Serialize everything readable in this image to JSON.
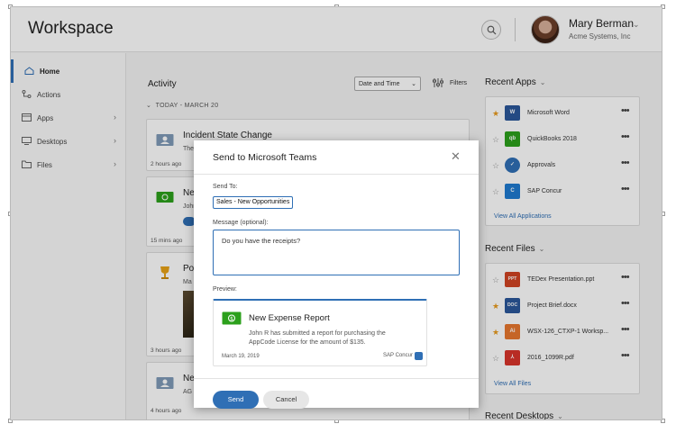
{
  "header": {
    "app_title": "Workspace",
    "user_name": "Mary Berman",
    "user_org": "Acme Systems, Inc"
  },
  "sidebar": {
    "items": [
      {
        "label": "Home",
        "icon": "home-icon"
      },
      {
        "label": "Actions",
        "icon": "actions-icon"
      },
      {
        "label": "Apps",
        "icon": "apps-icon"
      },
      {
        "label": "Desktops",
        "icon": "desktop-icon"
      },
      {
        "label": "Files",
        "icon": "folder-icon"
      }
    ]
  },
  "activity": {
    "title": "Activity",
    "sort_select": "Date and Time",
    "filters_label": "Filters",
    "group_label": "TODAY - MARCH 20",
    "cards": [
      {
        "title": "Incident State Change",
        "body": "The",
        "time": "2 hours ago",
        "icon": "id-card-icon"
      },
      {
        "title": "Ne",
        "body": "John",
        "time": "15 mins ago",
        "icon": "money-icon"
      },
      {
        "title": "Po",
        "body": "Ma",
        "time": "3 hours ago",
        "icon": "trophy-icon"
      },
      {
        "title": "Ne",
        "body": "AG",
        "time": "4 hours ago",
        "icon": "id-card-icon"
      }
    ]
  },
  "recent_apps": {
    "title": "Recent Apps",
    "items": [
      {
        "label": "Microsoft Word",
        "starred": true,
        "icon": "word-icon",
        "color": "#2b579a",
        "glyph": "W"
      },
      {
        "label": "QuickBooks 2018",
        "starred": false,
        "icon": "quickbooks-icon",
        "color": "#2ca01c",
        "glyph": "qb"
      },
      {
        "label": "Approvals",
        "starred": false,
        "icon": "approvals-icon",
        "color": "#2f6fb5",
        "glyph": "✓"
      },
      {
        "label": "SAP Concur",
        "starred": false,
        "icon": "concur-icon",
        "color": "#1f7bd0",
        "glyph": "C"
      }
    ],
    "link": "View All Applications"
  },
  "recent_files": {
    "title": "Recent Files",
    "items": [
      {
        "label": "TEDex Presentation.ppt",
        "starred": false,
        "icon": "ppt-icon",
        "color": "#d04423",
        "glyph": "PPT"
      },
      {
        "label": "Project Brief.docx",
        "starred": true,
        "icon": "doc-icon",
        "color": "#2b579a",
        "glyph": "DOC"
      },
      {
        "label": "WSX-126_CTXP-1 Worksp...",
        "starred": true,
        "icon": "ai-icon",
        "color": "#e8772e",
        "glyph": "Ai"
      },
      {
        "label": "2016_1099R.pdf",
        "starred": false,
        "icon": "pdf-icon",
        "color": "#d9342b",
        "glyph": "⅄"
      }
    ],
    "link": "View All Files"
  },
  "recent_desktops": {
    "title": "Recent Desktops"
  },
  "modal": {
    "title": "Send to Microsoft Teams",
    "send_to_label": "Send To:",
    "send_to_value": "Sales - New Opportunities",
    "message_label": "Message (optional):",
    "message_value": "Do you have the receipts?",
    "preview_label": "Preview:",
    "preview": {
      "title": "New Expense Report",
      "body": "John R has submitted a report for purchasing the AppCode License for the amount of $135.",
      "date": "March 19, 2019",
      "source": "SAP Concur"
    },
    "send_button": "Send",
    "cancel_button": "Cancel"
  },
  "colors": {
    "accent": "#2f6fb5",
    "star": "#e89b1e",
    "money_green": "#2ca01c"
  }
}
